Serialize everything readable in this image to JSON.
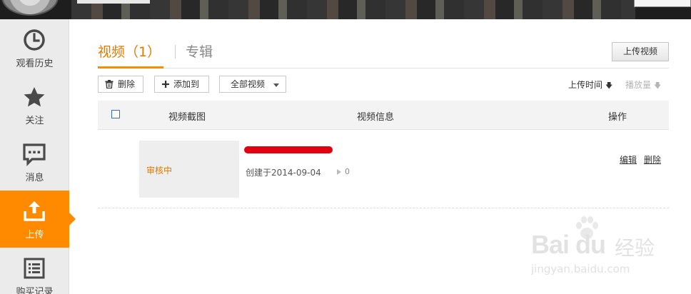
{
  "sidebar": {
    "items": [
      {
        "label": "观看历史",
        "icon": "clock-icon",
        "active": false
      },
      {
        "label": "关注",
        "icon": "star-icon",
        "active": false
      },
      {
        "label": "消息",
        "icon": "message-icon",
        "active": false
      },
      {
        "label": "上传",
        "icon": "upload-icon",
        "active": true
      },
      {
        "label": "购买记录",
        "icon": "list-icon",
        "active": false
      }
    ]
  },
  "tabs": [
    {
      "label": "视频（1）",
      "active": true
    },
    {
      "label": "专辑",
      "active": false
    }
  ],
  "toolbar": {
    "upload_label": "上传视频",
    "delete_label": "删除",
    "add_to_label": "添加到",
    "filter_label": "全部视频",
    "sort_time_label": "上传时间",
    "sort_plays_label": "播放量"
  },
  "table": {
    "headers": [
      "视频截图",
      "视频信息",
      "操作"
    ],
    "rows": [
      {
        "thumb_status": "审核中",
        "created": "创建于2014-09-04",
        "plays": "0",
        "actions": [
          "编辑",
          "删除"
        ]
      }
    ]
  },
  "watermark": {
    "logo": "Bai du",
    "cn": "经验",
    "url": "jingyan.baidu.com"
  },
  "colors": {
    "accent": "#ff8a00",
    "accent_text": "#e07b00",
    "sidebar_bg": "#ebebeb",
    "redaction": "#e00010"
  }
}
